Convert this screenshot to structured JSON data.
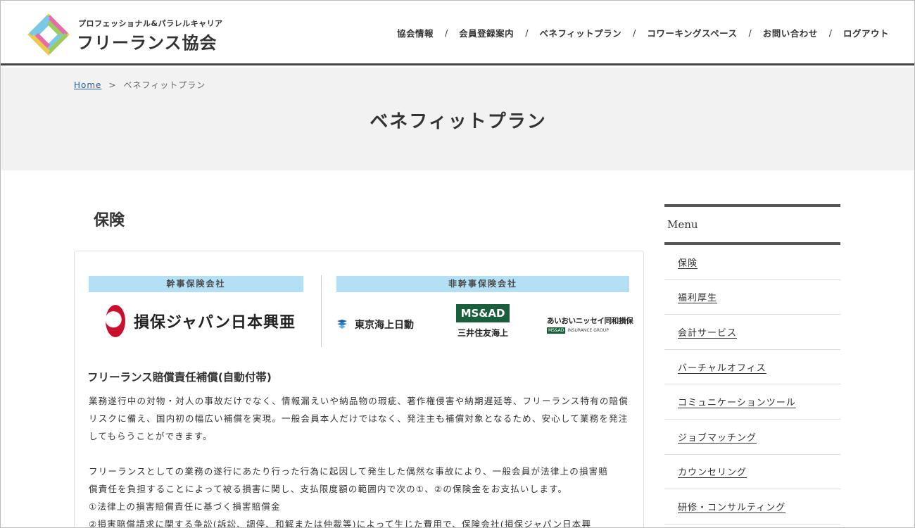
{
  "header": {
    "logo_sub": "プロフェッショナル&パラレルキャリア",
    "logo_main": "フリーランス協会",
    "nav": [
      "協会情報",
      "会員登録案内",
      "ベネフィットプラン",
      "コワーキングスペース",
      "お問い合わせ",
      "ログアウト"
    ],
    "nav_separator": "/"
  },
  "breadcrumb": {
    "home": "Home",
    "separator": ">",
    "current": "ベネフィットプラン"
  },
  "page_title": "ベネフィットプラン",
  "main": {
    "section_title": "保険",
    "insurers": {
      "main_label": "幹事保険会社",
      "sub_label": "非幹事保険会社",
      "sompo": "損保ジャパン日本興亜",
      "tokio": "東京海上日動",
      "msad_box": "MS&AD",
      "msad_sub": "三井住友海上",
      "aioi": "あいおいニッセイ同和損保",
      "aioi_tag": "MS&AD",
      "aioi_tag2": "INSURANCE GROUP"
    },
    "sub_heading": "フリーランス賠償責任補償(自動付帯)",
    "paragraph1": "業務遂行中の対物・対人の事故だけでなく、情報漏えいや納品物の瑕疵、著作権侵害や納期遅延等、フリーランス特有の賠償リスクに備え、国内初の幅広い補償を実現。一般会員本人だけではなく、発注主も補償対象となるため、安心して業務を発注してもらうことができます。",
    "paragraph2_lines": [
      "フリーランスとしての業務の遂行にあたり行った行為に起因して発生した偶然な事故により、一般会員が法律上の損害賠",
      "償責任を負担することによって被る損害に関し、支払限度額の範囲内で次の①、②の保険金をお支払いします。",
      "①法律上の損害賠償責任に基づく損害賠償金",
      "②損害賠償請求に関する争訟(訴訟、調停、和解または仲裁等)によって生じた費用で、保険会社(損保ジャパン日本興"
    ]
  },
  "sidebar": {
    "title": "Menu",
    "items": [
      "保険",
      "福利厚生",
      "会計サービス",
      "バーチャルオフィス",
      "コミュニケーションツール",
      "ジョブマッチング",
      "カウンセリング",
      "研修・コンサルティング"
    ]
  },
  "colors": {
    "label_bg": "#b3e0f5",
    "sompo_red": "#c8102e",
    "msad_green": "#1b5e3b",
    "link_blue": "#2a5aa0"
  }
}
